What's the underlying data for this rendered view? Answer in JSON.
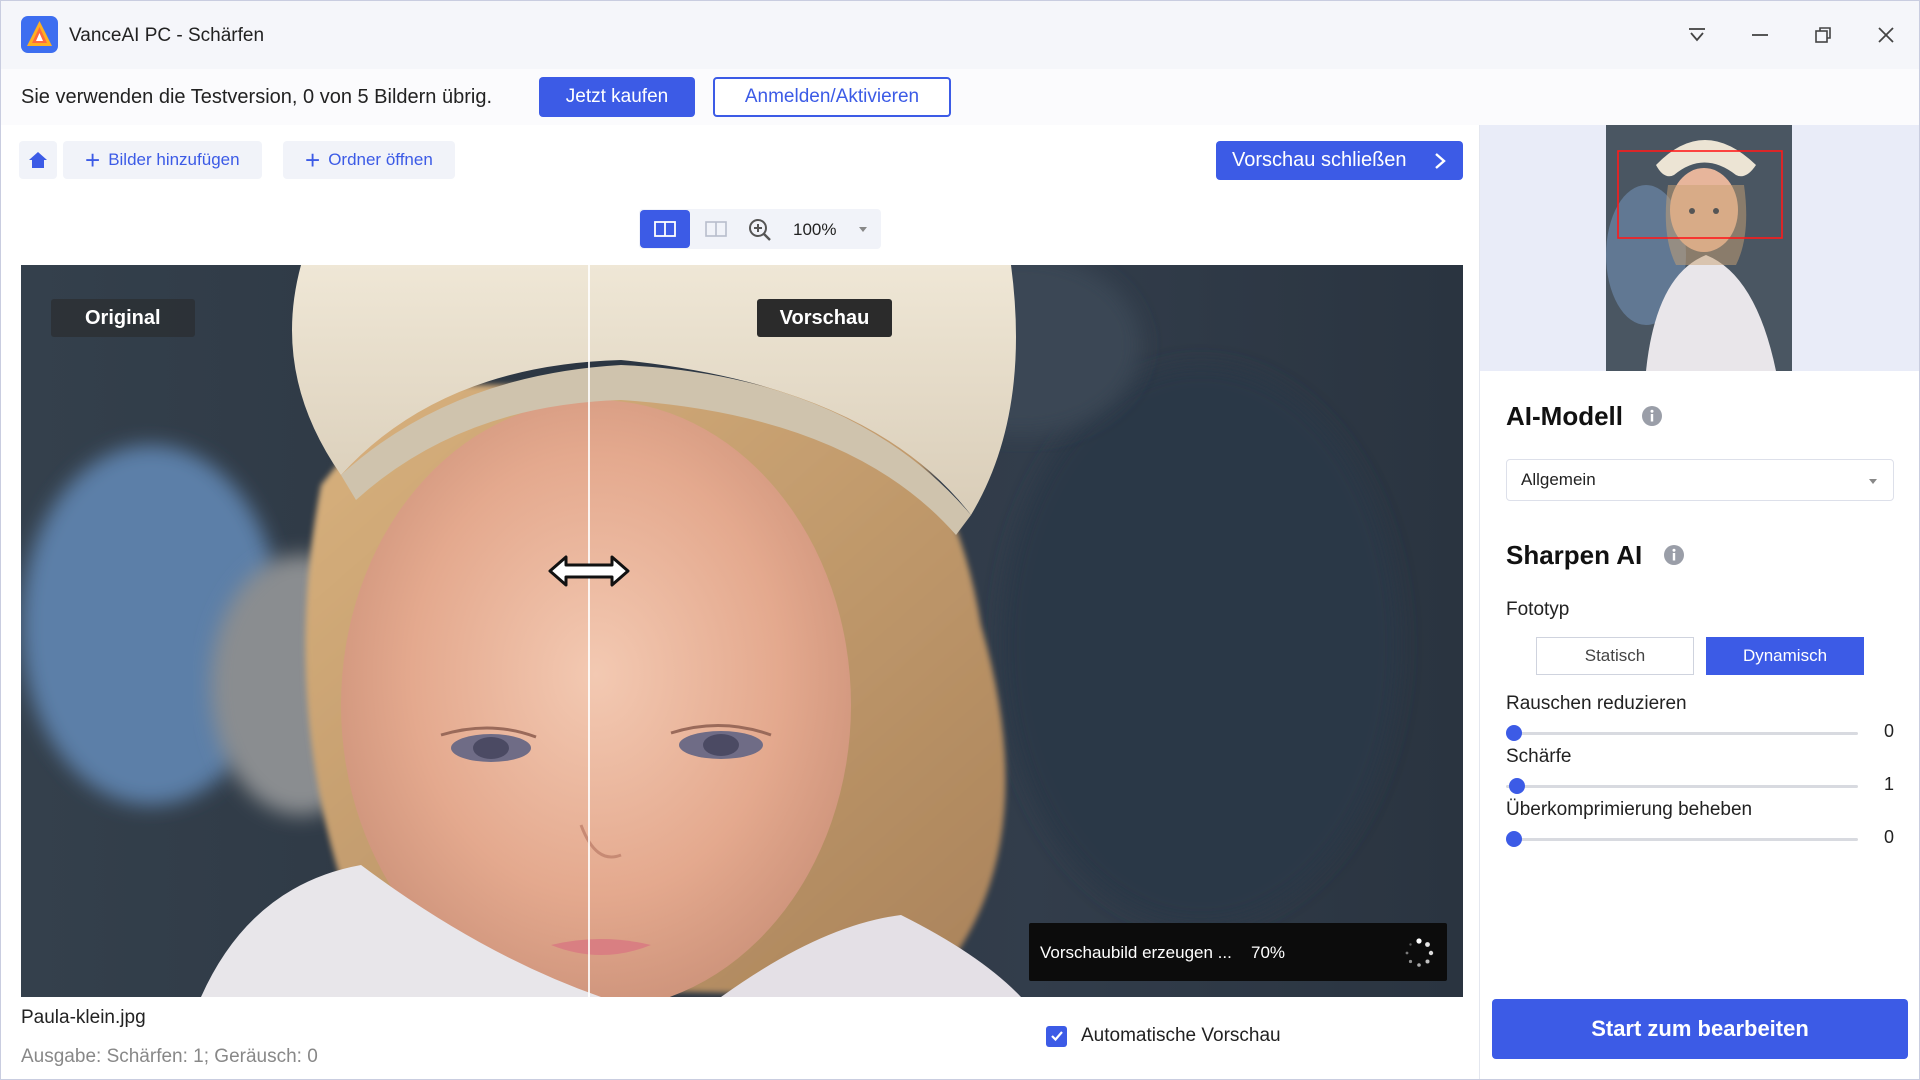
{
  "window": {
    "title": "VanceAI PC - Schärfen"
  },
  "trial": {
    "message": "Sie verwenden die Testversion, 0 von 5 Bildern übrig.",
    "buy_label": "Jetzt kaufen",
    "login_label": "Anmelden/Aktivieren"
  },
  "toolbar": {
    "add_images_label": "Bilder hinzufügen",
    "open_folder_label": "Ordner öffnen",
    "close_preview_label": "Vorschau schließen"
  },
  "view": {
    "zoom_level": "100%"
  },
  "image": {
    "original_label": "Original",
    "preview_label": "Vorschau",
    "progress_text": "Vorschaubild erzeugen ...",
    "progress_percent": "70%"
  },
  "footer": {
    "file_name": "Paula-klein.jpg",
    "output_info": "Ausgabe: Schärfen: 1; Geräusch: 0",
    "auto_preview_label": "Automatische Vorschau",
    "auto_preview_checked": true
  },
  "panel": {
    "ai_model_title": "AI-Modell",
    "ai_model_value": "Allgemein",
    "sharpen_title": "Sharpen AI",
    "photo_type_label": "Fototyp",
    "photo_type_options": [
      "Statisch",
      "Dynamisch"
    ],
    "photo_type_selected": "Dynamisch",
    "sliders": [
      {
        "label": "Rauschen reduzieren",
        "value": "0",
        "fraction": 0.0
      },
      {
        "label": "Schärfe",
        "value": "1",
        "fraction": 0.01
      },
      {
        "label": "Überkomprimierung beheben",
        "value": "0",
        "fraction": 0.0
      }
    ],
    "start_label": "Start zum bearbeiten"
  },
  "colors": {
    "accent": "#3c5be6",
    "titlebar": "#f5f6fa",
    "thumb_bg": "#e9ecf8"
  }
}
